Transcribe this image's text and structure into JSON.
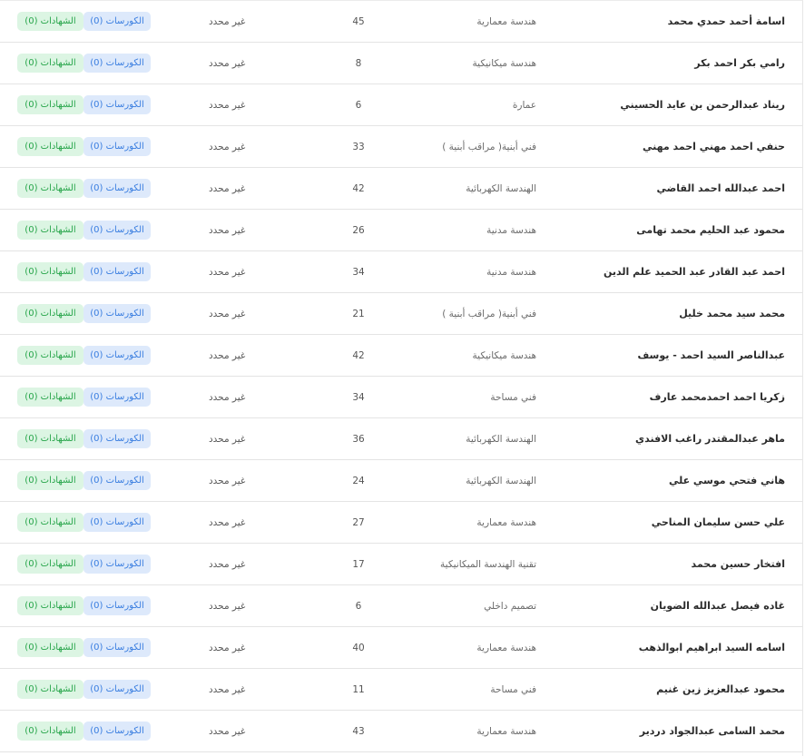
{
  "labels": {
    "status_undefined": "غير محدد",
    "courses_badge": "الكورسات (0)",
    "certificates_badge": "الشهادات (0)"
  },
  "colors": {
    "certificates_bg": "#dcf5e3",
    "certificates_fg": "#27a54a",
    "courses_bg": "#dde9fb",
    "courses_fg": "#3a7ee0"
  },
  "rows": [
    {
      "name": "اسامة أحمد حمدي محمد",
      "specialty": "هندسة معمارية",
      "number": "45",
      "status": "غير محدد",
      "courses": "الكورسات (0)",
      "certificates": "الشهادات (0)"
    },
    {
      "name": "رامي بكر احمد بكر",
      "specialty": "هندسة ميكانيكية",
      "number": "8",
      "status": "غير محدد",
      "courses": "الكورسات (0)",
      "certificates": "الشهادات (0)"
    },
    {
      "name": "ريناد عبدالرحمن بن عايد الحسيني",
      "specialty": "عمارة",
      "number": "6",
      "status": "غير محدد",
      "courses": "الكورسات (0)",
      "certificates": "الشهادات (0)"
    },
    {
      "name": "حنفي احمد مهني احمد مهني",
      "specialty": "فني أبنية( مراقب أبنية )",
      "number": "33",
      "status": "غير محدد",
      "courses": "الكورسات (0)",
      "certificates": "الشهادات (0)"
    },
    {
      "name": "احمد عبدالله احمد القاضي",
      "specialty": "الهندسة الكهربائية",
      "number": "42",
      "status": "غير محدد",
      "courses": "الكورسات (0)",
      "certificates": "الشهادات (0)"
    },
    {
      "name": "محمود عبد الحليم محمد تهامى",
      "specialty": "هندسة مدنية",
      "number": "26",
      "status": "غير محدد",
      "courses": "الكورسات (0)",
      "certificates": "الشهادات (0)"
    },
    {
      "name": "احمد عبد القادر عبد الحميد علم الدين",
      "specialty": "هندسة مدنية",
      "number": "34",
      "status": "غير محدد",
      "courses": "الكورسات (0)",
      "certificates": "الشهادات (0)"
    },
    {
      "name": "محمد سيد محمد خليل",
      "specialty": "فني أبنية( مراقب أبنية )",
      "number": "21",
      "status": "غير محدد",
      "courses": "الكورسات (0)",
      "certificates": "الشهادات (0)"
    },
    {
      "name": "عبدالناصر السيد احمد - يوسف",
      "specialty": "هندسة ميكانيكية",
      "number": "42",
      "status": "غير محدد",
      "courses": "الكورسات (0)",
      "certificates": "الشهادات (0)"
    },
    {
      "name": "زكريا احمد احمدمحمد عارف",
      "specialty": "فني مساحة",
      "number": "34",
      "status": "غير محدد",
      "courses": "الكورسات (0)",
      "certificates": "الشهادات (0)"
    },
    {
      "name": "ماهر عبدالمقتدر راغب الافندي",
      "specialty": "الهندسة الكهربائية",
      "number": "36",
      "status": "غير محدد",
      "courses": "الكورسات (0)",
      "certificates": "الشهادات (0)"
    },
    {
      "name": "هاني فتحي موسي علي",
      "specialty": "الهندسة الكهربائية",
      "number": "24",
      "status": "غير محدد",
      "courses": "الكورسات (0)",
      "certificates": "الشهادات (0)"
    },
    {
      "name": "علي حسن سليمان المناحي",
      "specialty": "هندسة معمارية",
      "number": "27",
      "status": "غير محدد",
      "courses": "الكورسات (0)",
      "certificates": "الشهادات (0)"
    },
    {
      "name": "افتخار حسين محمد",
      "specialty": "تقنية الهندسة الميكانيكية",
      "number": "17",
      "status": "غير محدد",
      "courses": "الكورسات (0)",
      "certificates": "الشهادات (0)"
    },
    {
      "name": "غاده فيصل عبدالله الضويان",
      "specialty": "تصميم داخلي",
      "number": "6",
      "status": "غير محدد",
      "courses": "الكورسات (0)",
      "certificates": "الشهادات (0)"
    },
    {
      "name": "اسامه السيد ابراهيم ابوالذهب",
      "specialty": "هندسة معمارية",
      "number": "40",
      "status": "غير محدد",
      "courses": "الكورسات (0)",
      "certificates": "الشهادات (0)"
    },
    {
      "name": "محمود عبدالعزيز زين غنيم",
      "specialty": "فني مساحة",
      "number": "11",
      "status": "غير محدد",
      "courses": "الكورسات (0)",
      "certificates": "الشهادات (0)"
    },
    {
      "name": "محمد السامى عبدالجواد دردير",
      "specialty": "هندسة معمارية",
      "number": "43",
      "status": "غير محدد",
      "courses": "الكورسات (0)",
      "certificates": "الشهادات (0)"
    }
  ]
}
